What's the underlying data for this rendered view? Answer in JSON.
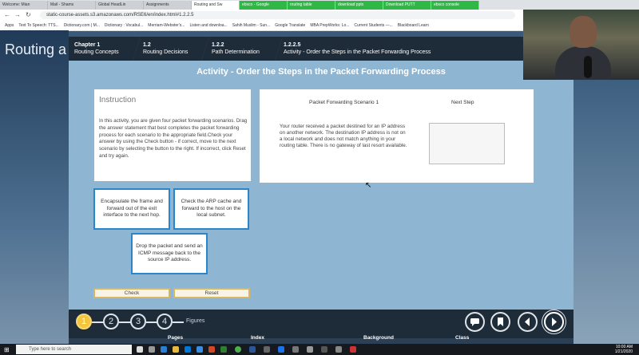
{
  "browser": {
    "tabs": [
      {
        "label": "Welcome: Mian"
      },
      {
        "label": "Mail - Shams"
      },
      {
        "label": "Global HeadLin"
      },
      {
        "label": "Assignments"
      },
      {
        "label": "Routing and Sw",
        "active": true
      },
      {
        "label": "ebsco - Google"
      },
      {
        "label": "routing table"
      },
      {
        "label": "download pptx"
      },
      {
        "label": "Download PUTT"
      },
      {
        "label": "ebsco console"
      }
    ],
    "url": "static-course-assets.s3.amazonaws.com/RSE6/en/index.html#1.2.2.5",
    "bookmarks": [
      "Apps",
      "Text To Speech: TTS...",
      "Dictionary.com | M...",
      "Dictionary : Vocabul...",
      "Merriam-Webster's...",
      "Listen and downloa...",
      "Sahih Muslim - Sun...",
      "Google Translate",
      "MBA PrepWorks: Lo...",
      "Current Students —...",
      "Blackboard Learn"
    ]
  },
  "desktop": {
    "bg_text": "Routing a"
  },
  "breadcrumbs": [
    {
      "num": "Chapter 1",
      "label": "Routing Concepts"
    },
    {
      "num": "1.2",
      "label": "Routing Decisions"
    },
    {
      "num": "1.2.2",
      "label": "Path Determination"
    },
    {
      "num": "1.2.2.5",
      "label": "Activity - Order the Steps in the Packet Forwarding Process"
    }
  ],
  "activity_title": "Activity - Order the Steps in the Packet Forwarding Process",
  "instruction": {
    "title": "Instruction",
    "text": "In this activity, you are given four packet forwarding scenarios. Drag the answer statement that best completes the packet forwarding process for each scenario to the appropriate field.Check your answer by using the Check button - if correct, move to the next scenario by selecting the button to the right. If incorrect, click Reset and try again."
  },
  "scenario": {
    "title": "Packet Forwarding Scenario 1",
    "next_step_label": "Next Step",
    "text": "Your router received a packet destined for an IP address on another network. The destination IP address is not on a local network and does not match anything in your routing table. There is no gateway of last resort available."
  },
  "answers": [
    "Encapsulate the frame and forward out of the exit interface to the next hop.",
    "Check the ARP cache and forward to the host on the local subnet.",
    "Drop the packet and send an ICMP message back to the source IP address."
  ],
  "buttons": {
    "check": "Check",
    "reset": "Reset"
  },
  "footer": {
    "steps": [
      "1",
      "2",
      "3",
      "4"
    ],
    "active_step": 1,
    "figures_label": "Figures"
  },
  "bottom_strip": [
    "Pages",
    "Index",
    "Background",
    "Class"
  ],
  "taskbar": {
    "search_placeholder": "Type here to search",
    "time": "10:00 AM",
    "date": "1/21/2020"
  },
  "colors": {
    "header": "#1e2b38",
    "panel": "#8eb5d1",
    "accent_blue": "#2a86c8",
    "active_step": "#f4c53e"
  }
}
